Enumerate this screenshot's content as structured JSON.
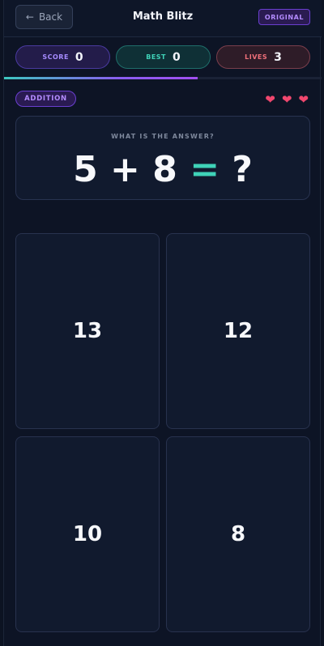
{
  "header": {
    "back_label": "Back",
    "title": "Math Blitz",
    "mode_badge": "ORIGINAL"
  },
  "stats": {
    "score_label": "SCORE",
    "score_value": "0",
    "best_label": "BEST",
    "best_value": "0",
    "lives_label": "LIVES",
    "lives_value": "3"
  },
  "progress": {
    "fraction": 0.61
  },
  "category": "ADDITION",
  "hearts": [
    "heart",
    "heart",
    "heart"
  ],
  "question": {
    "prompt": "WHAT IS THE ANSWER?",
    "operand_a": "5",
    "operator": "+",
    "operand_b": "8",
    "equals": "=",
    "unknown": "?"
  },
  "answers": [
    "13",
    "12",
    "10",
    "8"
  ],
  "colors": {
    "background": "#0d1425",
    "accent_purple": "#8a5cf0",
    "accent_teal": "#3fd3b8",
    "accent_red": "#f0476e"
  }
}
